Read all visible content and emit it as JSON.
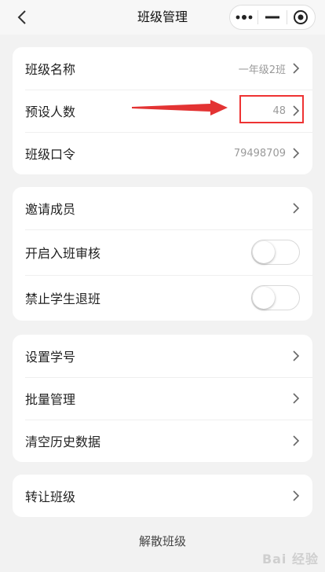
{
  "nav": {
    "title": "班级管理"
  },
  "class_info": {
    "name_label": "班级名称",
    "name_value": "一年级2班",
    "size_label": "预设人数",
    "size_value": "48",
    "code_label": "班级口令",
    "code_value": "79498709"
  },
  "members": {
    "invite_label": "邀请成员",
    "review_label": "开启入班审核",
    "review_on": false,
    "forbid_quit_label": "禁止学生退班",
    "forbid_quit_on": false
  },
  "data_mgmt": {
    "student_id_label": "设置学号",
    "batch_label": "批量管理",
    "clear_history_label": "清空历史数据"
  },
  "transfer": {
    "label": "转让班级"
  },
  "dissolve": {
    "label": "解散班级"
  },
  "watermark": {
    "text": "Bai 经验"
  },
  "colors": {
    "annotation": "#e33333",
    "background": "#f2f2f2"
  }
}
